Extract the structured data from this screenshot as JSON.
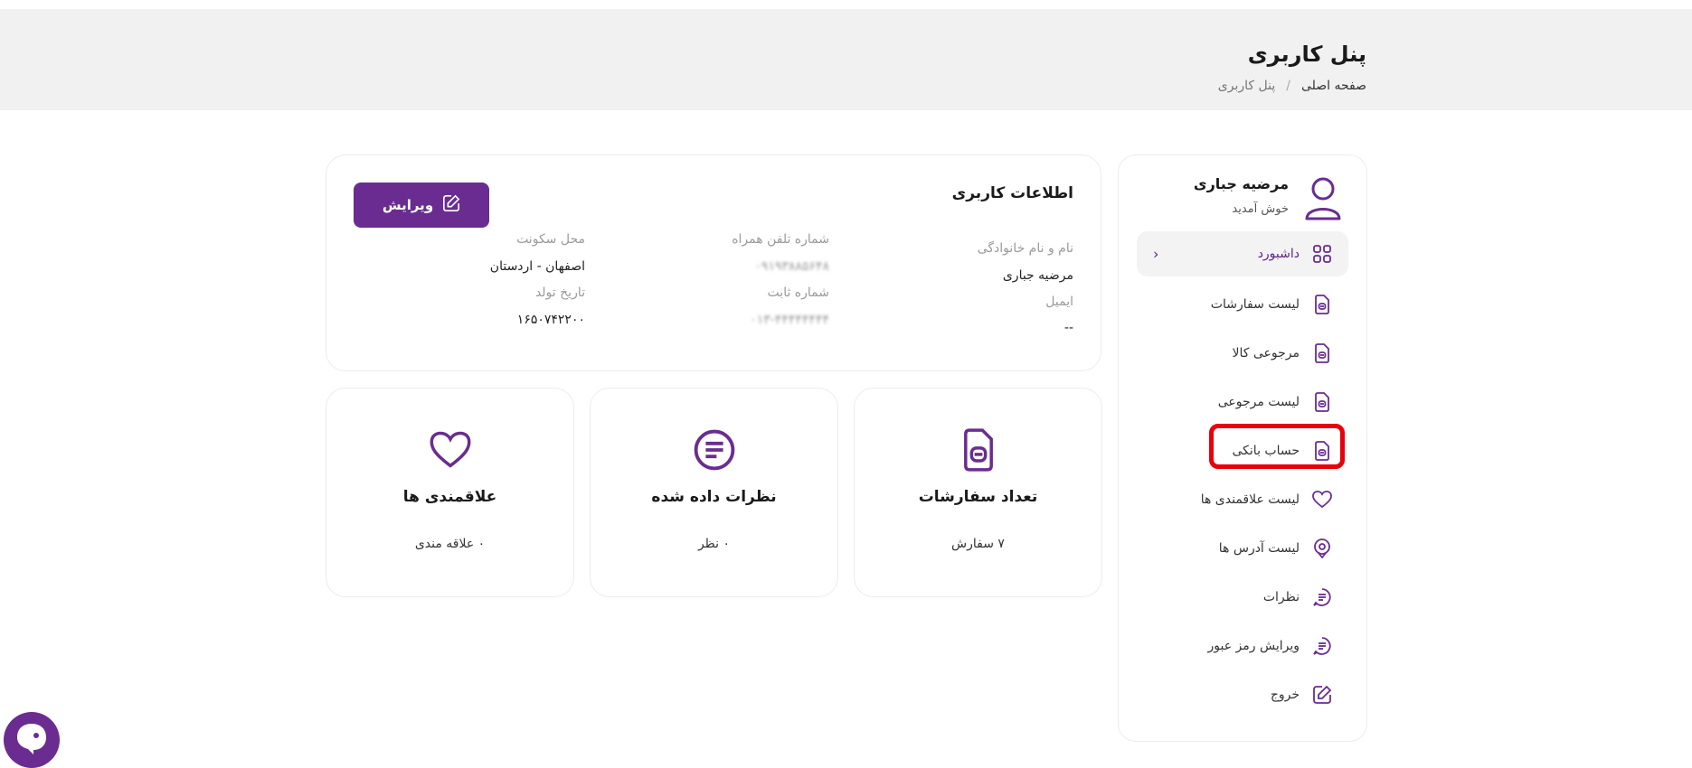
{
  "header": {
    "title": "پنل کاربری",
    "breadcrumb": {
      "home": "صفحه اصلی",
      "separator": "/",
      "current": "پنل کاربری"
    }
  },
  "sidebar": {
    "user_name": "مرضیه جباری",
    "welcome": "خوش آمدید",
    "items": [
      {
        "label": "داشبورد",
        "icon": "grid-icon"
      },
      {
        "label": "لیست سفارشات",
        "icon": "document-icon"
      },
      {
        "label": "مرجوعی کالا",
        "icon": "document-icon"
      },
      {
        "label": "لیست مرجوعی",
        "icon": "document-icon"
      },
      {
        "label": "حساب بانکی",
        "icon": "document-icon"
      },
      {
        "label": "لیست علاقمندی ها",
        "icon": "heart-icon"
      },
      {
        "label": "لیست آدرس ها",
        "icon": "location-icon"
      },
      {
        "label": "نظرات",
        "icon": "comment-icon"
      },
      {
        "label": "ویرایش رمز عبور",
        "icon": "comment-icon"
      },
      {
        "label": "خروج",
        "icon": "edit-icon"
      }
    ],
    "active_chevron": "‹"
  },
  "info": {
    "title": "اطلاعات کاربری",
    "edit_label": "ویرایش",
    "fields": {
      "name_label": "نام و نام خانوادگی",
      "name_value": "مرضیه جباری",
      "email_label": "ایمیل",
      "email_value": "--",
      "mobile_label": "شماره تلفن همراه",
      "mobile_value": "۰۹۱۹۳۸۸۵۶۴۸",
      "landline_label": "شماره ثابت",
      "landline_value": "۰۱۳-۴۴۴۴۴۴۴۴",
      "residence_label": "محل سکونت",
      "residence_value": "اصفهان - اردستان",
      "birth_label": "تاریخ تولد",
      "birth_value": "۱۶۵۰۷۴۲۲۰۰"
    }
  },
  "stats": [
    {
      "title": "تعداد سفارشات",
      "value": "۷ سفارش",
      "icon": "document-icon"
    },
    {
      "title": "نظرات داده شده",
      "value": "۰ نظر",
      "icon": "comment-icon"
    },
    {
      "title": "علاقمندی ها",
      "value": "۰ علاقه مندی",
      "icon": "heart-icon"
    }
  ],
  "colors": {
    "accent": "#6a2c91",
    "highlight": "#e8000b",
    "header_bg": "#f1f1f1"
  }
}
